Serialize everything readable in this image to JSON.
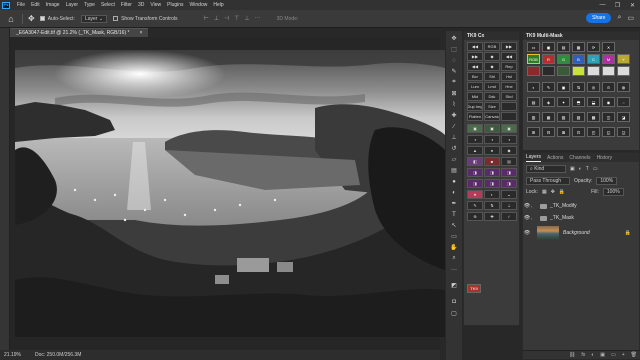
{
  "menubar": {
    "logo": "Ps",
    "items": [
      "File",
      "Edit",
      "Image",
      "Layer",
      "Type",
      "Select",
      "Filter",
      "3D",
      "View",
      "Plugins",
      "Window",
      "Help"
    ],
    "controls": [
      "—",
      "❐",
      "✕"
    ]
  },
  "options": {
    "auto_select_label": "Auto-Select:",
    "auto_select_value": "Layer",
    "show_transform_label": "Show Transform Controls",
    "mode_3d_label": "3D Mode:",
    "share_label": "Share"
  },
  "document": {
    "tab_title": "_E6A3047-Edit.tif @ 21.2% (_TK_Mask, RGB/16) *",
    "close_label": "×"
  },
  "status": {
    "zoom": "21.19%",
    "doc_size": "Doc: 250.0M/256.3M"
  },
  "tk_cx": {
    "title": "TK9 Cx",
    "buttons": [
      "◀◀",
      "RGB",
      "▶▶",
      "▶▶",
      "◆",
      "◀◀",
      "◀◀",
      "◆",
      "Rep",
      "Bcr",
      "Shl",
      "Hsl",
      "Lum",
      "Lmd",
      "Hne",
      "Mid",
      "Dsk",
      "Shd",
      "Dup Img",
      "Size",
      "",
      "Flatten",
      "Canvas",
      ""
    ],
    "tag": "TK9"
  },
  "tk_mm": {
    "title": "TK9 Multi-Mask",
    "row1": [
      "RGB",
      "R",
      "G",
      "B",
      "C",
      "M",
      "Y"
    ],
    "row2": [
      "",
      "",
      "",
      "",
      "",
      "",
      ""
    ],
    "row1_colors": [
      "#2c7d2c",
      "#b62d2d",
      "#2e8d3a",
      "#2e5fbf",
      "#2ba3b8",
      "#b02fa4",
      "#b8a832"
    ]
  },
  "layers": {
    "tabs": [
      "Layers",
      "Actions",
      "Channels",
      "History"
    ],
    "filter_label": "Kind",
    "blend_mode": "Pass Through",
    "opacity_label": "Opacity:",
    "opacity_value": "100%",
    "lock_label": "Lock:",
    "fill_label": "Fill:",
    "fill_value": "100%",
    "items": [
      {
        "name": "_TK_Modify",
        "type": "group"
      },
      {
        "name": "_TK_Mask",
        "type": "group"
      },
      {
        "name": "Background",
        "type": "image"
      }
    ],
    "footer_icons": [
      "fx",
      "◐",
      "▣",
      "▭",
      "+",
      "🗑"
    ]
  }
}
